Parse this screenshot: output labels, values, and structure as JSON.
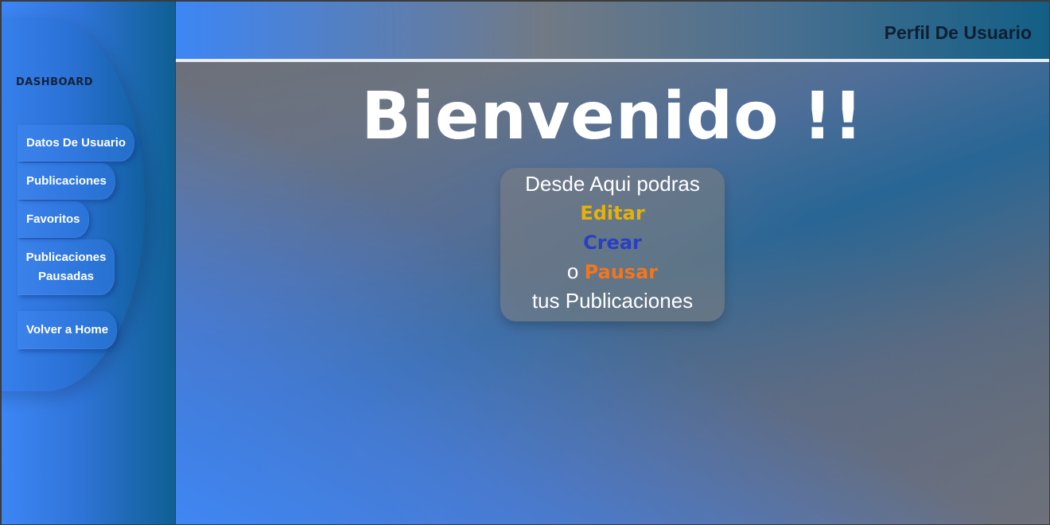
{
  "header": {
    "title": "Perfil De Usuario"
  },
  "sidebar": {
    "title": "DASHBOARD",
    "items": [
      {
        "label": "Datos De Usuario"
      },
      {
        "label": "Publicaciones"
      },
      {
        "label": "Favoritos"
      },
      {
        "label": "Publicaciones Pausadas"
      },
      {
        "label": "Volver a Home"
      }
    ]
  },
  "main": {
    "heading": "Bienvenido !!",
    "card": {
      "line1": "Desde Aqui podras",
      "edit": "Editar",
      "create": "Crear",
      "or": "o",
      "pause": "Pausar",
      "line5": "tus Publicaciones"
    }
  },
  "colors": {
    "accent_edit": "#e5b20a",
    "accent_create": "#2a3fc2",
    "accent_pause": "#f2761d",
    "sidebar_blue": "#3d86f5",
    "header_text": "#0f1f33"
  }
}
